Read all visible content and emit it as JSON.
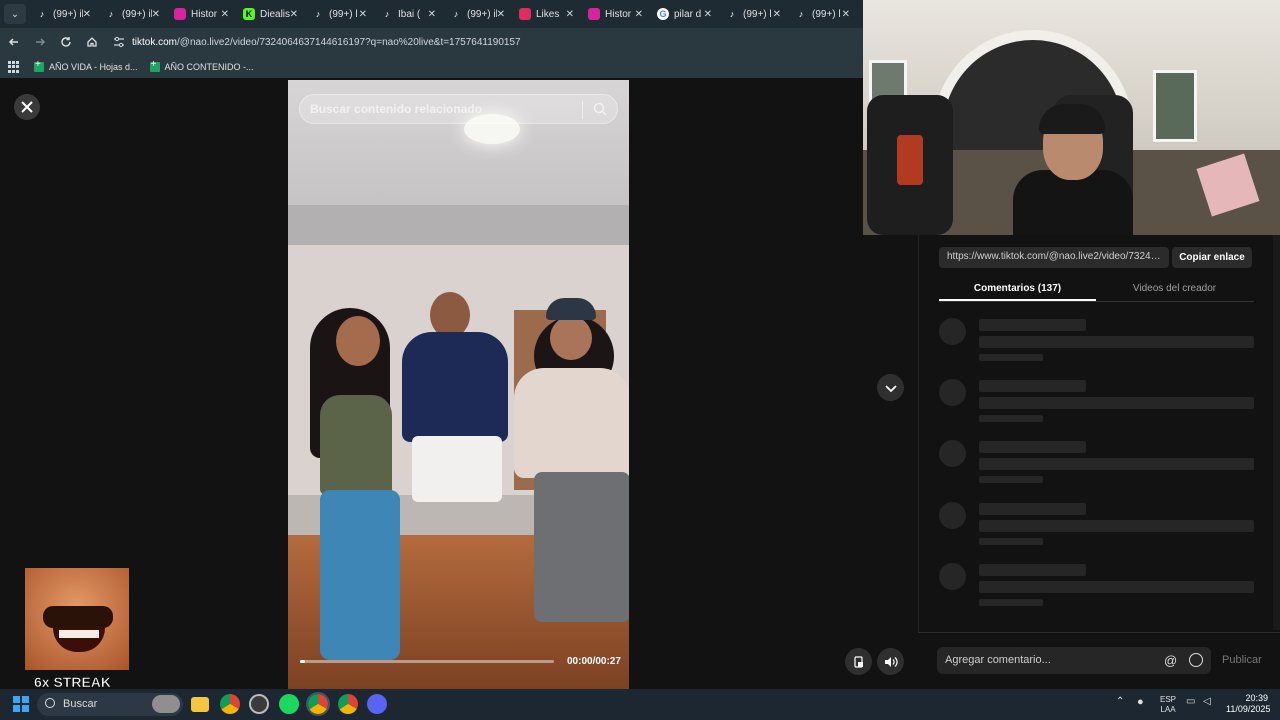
{
  "browser": {
    "tabs": [
      {
        "label": "(99+) il",
        "icon": "tiktok-icon",
        "color": "#000000"
      },
      {
        "label": "(99+) il",
        "icon": "tiktok-icon",
        "color": "#000000"
      },
      {
        "label": "Histor",
        "icon": "instagram-icon",
        "color": "#d6249f"
      },
      {
        "label": "Diealis",
        "icon": "kick-icon",
        "color": "#53fc18"
      },
      {
        "label": "(99+) l",
        "icon": "tiktok-icon",
        "color": "#000000"
      },
      {
        "label": "Ibai (",
        "icon": "tiktok-icon",
        "color": "#000000"
      },
      {
        "label": "(99+) il",
        "icon": "tiktok-icon",
        "color": "#000000"
      },
      {
        "label": "Likes",
        "icon": "likes-icon",
        "color": "#e02d5e"
      },
      {
        "label": "Histor",
        "icon": "instagram-icon",
        "color": "#d6249f"
      },
      {
        "label": "pilar d",
        "icon": "google-icon",
        "color": "#ffffff"
      },
      {
        "label": "(99+) l",
        "icon": "tiktok-icon",
        "color": "#000000"
      },
      {
        "label": "(99+) l",
        "icon": "tiktok-icon",
        "color": "#000000"
      }
    ],
    "url_host": "tiktok.com",
    "url_path": "/@nao.live2/video/7324064637144616197?q=nao%20live&t=1757641190157",
    "bookmarks": [
      "AÑO VIDA - Hojas d...",
      "AÑO CONTENIDO -..."
    ]
  },
  "video": {
    "search_placeholder": "Buscar contenido relacionado",
    "time": "00:00/00:27",
    "progress": 0.02
  },
  "panel": {
    "link": "https://www.tiktok.com/@nao.live2/video/73240...",
    "copy_label": "Copiar enlace",
    "tab_comments": "Comentarios (137)",
    "tab_creator": "Videos del creador",
    "comment_placeholder": "Agregar comentario...",
    "publish_label": "Publicar"
  },
  "overlay": {
    "streak_text": "6x STREAK"
  },
  "taskbar": {
    "search_label": "Buscar",
    "lang_top": "ESP",
    "lang_bottom": "LAA",
    "time": "20:39",
    "date": "11/09/2025"
  }
}
